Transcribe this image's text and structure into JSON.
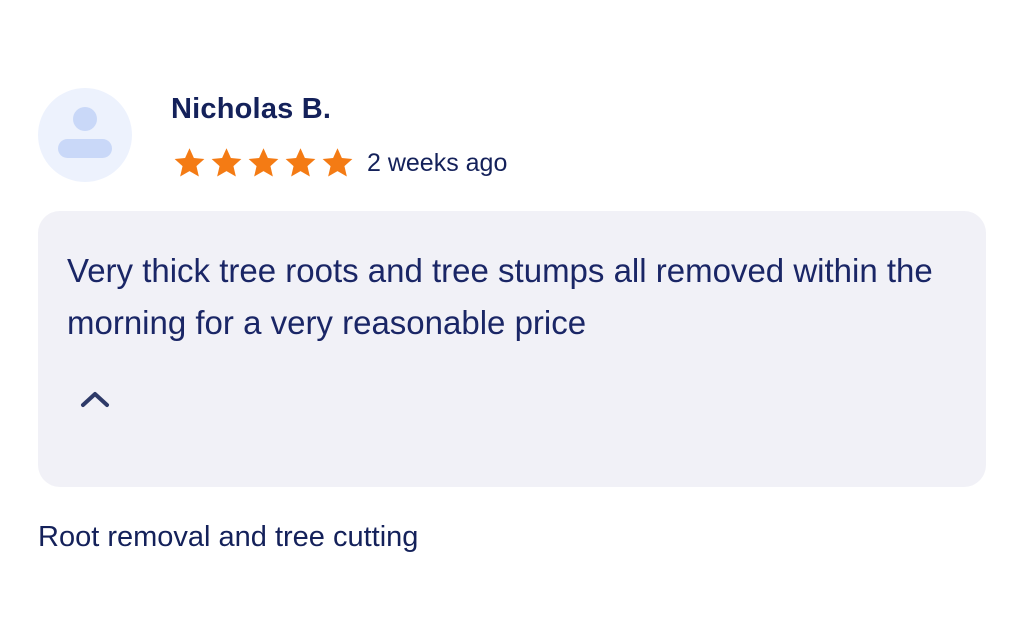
{
  "review": {
    "reviewer_name": "Nicholas B.",
    "rating": 5,
    "rating_max": 5,
    "time_ago": "2 weeks ago",
    "text": "Very thick tree roots and tree stumps all removed within the morning for a very reasonable price",
    "service": "Root removal and tree cutting"
  },
  "icons": {
    "avatar": "person-icon",
    "star": "star-icon",
    "collapse": "chevron-up-icon"
  },
  "colors": {
    "star": "#f47b14",
    "text": "#14215a",
    "review_box_bg": "#f1f1f7",
    "avatar_bg": "#edf2fd",
    "avatar_fg": "#c9d8f8",
    "chevron": "#2e3a68"
  }
}
